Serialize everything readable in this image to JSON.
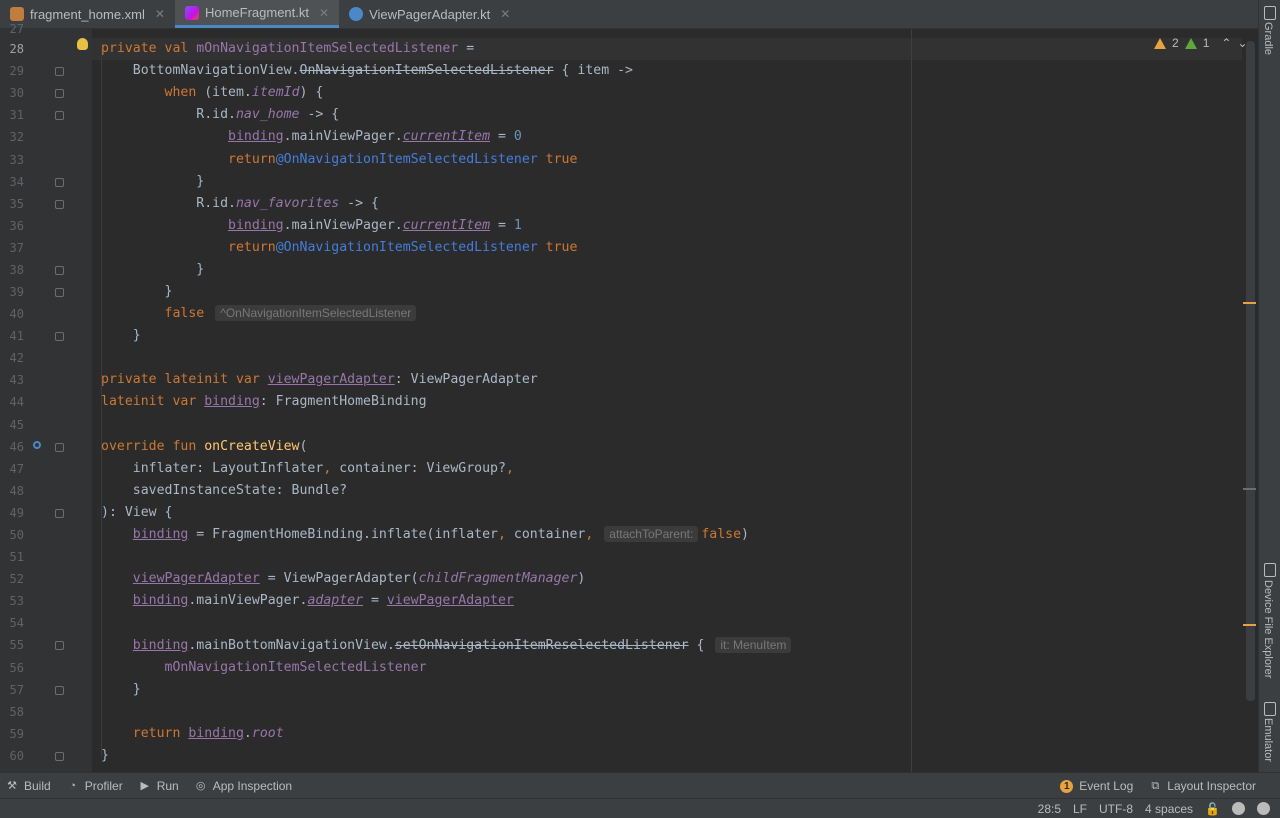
{
  "tabs": [
    {
      "label": "fragment_home.xml",
      "icon": "xml-file-icon",
      "active": false
    },
    {
      "label": "HomeFragment.kt",
      "icon": "kotlin-file-icon",
      "active": true
    },
    {
      "label": "ViewPagerAdapter.kt",
      "icon": "kotlin-class-icon",
      "active": false
    }
  ],
  "right_panel": {
    "gradle": "Gradle",
    "device_file_explorer": "Device File Explorer",
    "emulator": "Emulator"
  },
  "inspections": {
    "warnings": "2",
    "weak_warnings": "1"
  },
  "line_numbers": [
    "27",
    "28",
    "29",
    "30",
    "31",
    "32",
    "33",
    "34",
    "35",
    "36",
    "37",
    "38",
    "39",
    "40",
    "41",
    "42",
    "43",
    "44",
    "45",
    "46",
    "47",
    "48",
    "49",
    "50",
    "51",
    "52",
    "53",
    "54",
    "55",
    "56",
    "57",
    "58",
    "59",
    "60"
  ],
  "current_line": "28",
  "hints": {
    "return_label": "^OnNavigationItemSelectedListener",
    "attach_param": "attachToParent:",
    "it_type": "it: MenuItem"
  },
  "bottom_tools": {
    "build": "Build",
    "profiler": "Profiler",
    "run": "Run",
    "app_inspection": "App Inspection",
    "event_log": "Event Log",
    "event_log_count": "1",
    "layout_inspector": "Layout Inspector"
  },
  "status": {
    "position": "28:5",
    "line_sep": "LF",
    "encoding": "UTF-8",
    "indent": "4 spaces"
  },
  "colors": {
    "keyword": "#cc7832",
    "function": "#ffc66d",
    "number": "#6897bb",
    "property": "#9876aa",
    "label": "#467cda"
  }
}
